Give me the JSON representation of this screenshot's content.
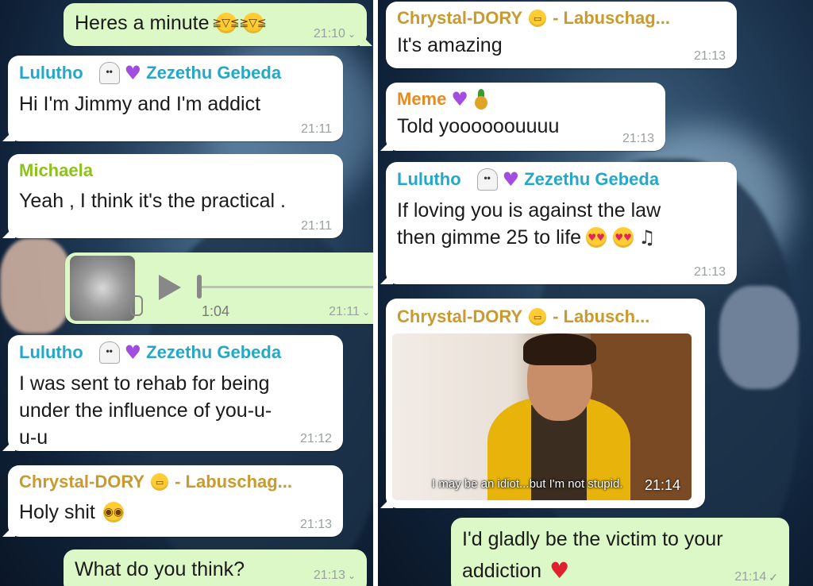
{
  "left": {
    "messages": [
      {
        "text": "Heres a minute",
        "time": "21:10"
      },
      {
        "sender": "Lulutho",
        "sender2": "Zezethu Gebeda",
        "text": "Hi I'm Jimmy and I'm addict",
        "time": "21:11"
      },
      {
        "sender": "Michaela",
        "text": "Yeah , I think it's the practical .",
        "time": "21:11"
      },
      {
        "duration": "1:04",
        "time": "21:11"
      },
      {
        "sender": "Lulutho",
        "sender2": "Zezethu Gebeda",
        "line1": "I was sent to rehab for being",
        "line2": "under the influence of you-u-",
        "line3": "u-u",
        "time": "21:12"
      },
      {
        "sender": "Chrystal-DORY",
        "sender2": "- Labuschag...",
        "text": "Holy shit",
        "time": "21:13"
      },
      {
        "text": "What do you think?",
        "time": "21:13"
      }
    ]
  },
  "right": {
    "messages": [
      {
        "sender": "Chrystal-DORY",
        "sender2": "- Labuschag...",
        "text": "It's amazing",
        "time": "21:13"
      },
      {
        "sender": "Meme",
        "text": "Told yoooooouuuu",
        "time": "21:13"
      },
      {
        "sender": "Lulutho",
        "sender2": "Zezethu Gebeda",
        "line1": "If loving you is against the law",
        "line2": "then gimme 25 to life",
        "time": "21:13"
      },
      {
        "sender": "Chrystal-DORY",
        "sender2": "- Labusch...",
        "caption": "I may be an idiot...but I'm not stupid.",
        "time": "21:14"
      },
      {
        "line1": "I'd gladly be the victim to your",
        "line2": "addiction",
        "time": "21:14"
      }
    ]
  },
  "colors": {
    "incoming_bubble": "#ffffff",
    "outgoing_bubble": "#dcf8c6",
    "sender_cyan": "#23a8c9",
    "sender_lime": "#8cc21a",
    "sender_gold": "#c99a2e",
    "sender_orange": "#e98a1e"
  }
}
